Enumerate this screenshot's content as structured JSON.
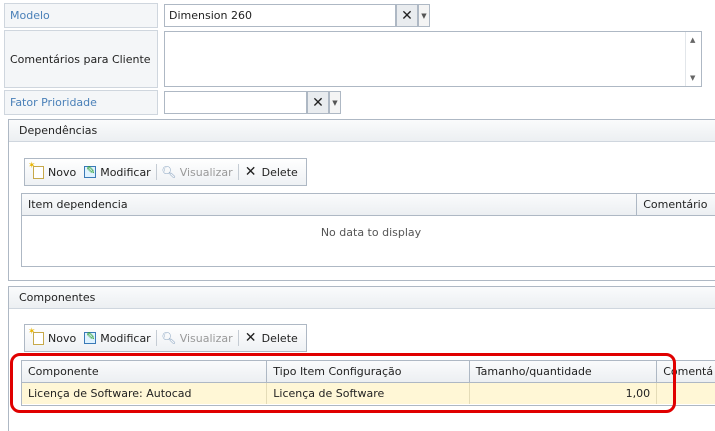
{
  "form": {
    "modelo_label": "Modelo",
    "modelo_value": "Dimension 260",
    "comentarios_label": "Comentários para Cliente",
    "comentarios_value": "",
    "fator_label": "Fator Prioridade",
    "fator_value": ""
  },
  "icons": {
    "clear": "close-x-icon",
    "dropdown": "chevron-down-icon",
    "new": "new-document-icon",
    "edit": "edit-icon",
    "view": "magnifier-icon",
    "delete": "delete-x-icon"
  },
  "toolbar": {
    "novo": "Novo",
    "modificar": "Modificar",
    "visualizar": "Visualizar",
    "delete": "Delete"
  },
  "dependencias": {
    "title": "Dependências",
    "columns": [
      "Item dependencia",
      "Comentário"
    ],
    "empty_text": "No data to display"
  },
  "componentes": {
    "title": "Componentes",
    "columns": [
      "Componente",
      "Tipo Item Configuração",
      "Tamanho/quantidade",
      "Comentá"
    ],
    "rows": [
      [
        "Licença de Software: Autocad",
        "Licença de Software",
        "1,00",
        ""
      ]
    ]
  },
  "colors": {
    "label_blue": "#4a80b8",
    "highlight_red": "#e00000",
    "selected_row": "#fff7d6"
  }
}
